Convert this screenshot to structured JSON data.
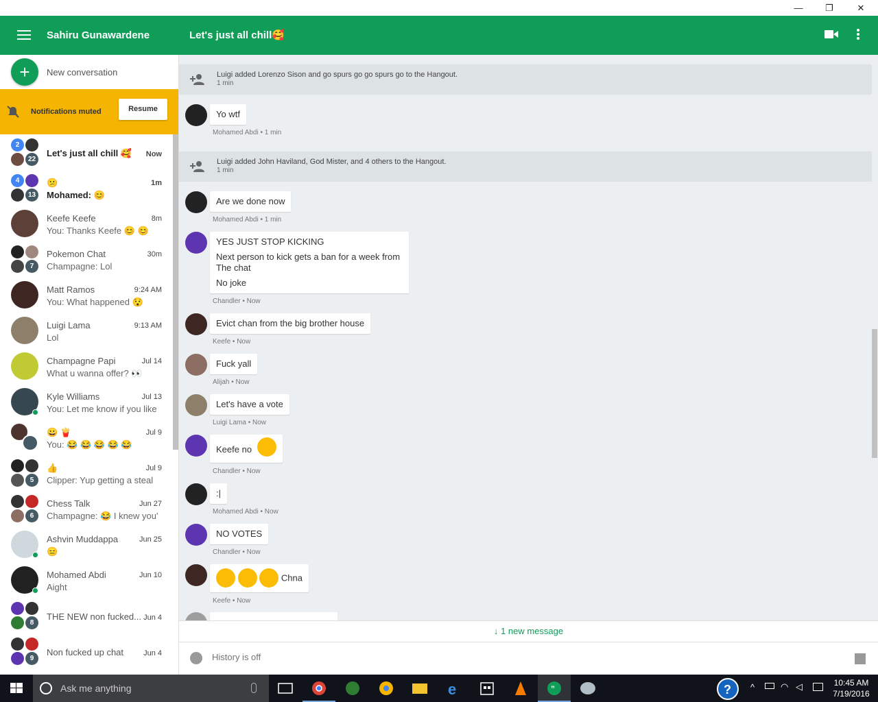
{
  "window": {
    "minimize": "—",
    "restore": "❐",
    "close": "✕"
  },
  "header": {
    "user_name": "Sahiru Gunawardene",
    "conversation_title": "Let's just all chill🥰"
  },
  "sidebar": {
    "new_conversation": "New conversation",
    "notifications_muted": "Notifications muted",
    "resume": "Resume",
    "conversations": [
      {
        "name": "Let's just all chill 🥰",
        "sub": "",
        "time": "Now",
        "badge_top": "2",
        "badge_bottom": "22",
        "bold": true
      },
      {
        "name": "😕",
        "sub": "Mohamed: 😊",
        "time": "1m",
        "badge_top": "4",
        "badge_bottom": "13",
        "bold": true
      },
      {
        "name": "Keefe Keefe",
        "sub": "You: Thanks Keefe 😊 😊",
        "time": "8m"
      },
      {
        "name": "Pokemon Chat",
        "sub": "Champagne: Lol",
        "time": "30m",
        "badge_bottom": "7"
      },
      {
        "name": "Matt Ramos",
        "sub": "You: What happened 😯",
        "time": "9:24 AM"
      },
      {
        "name": "Luigi Lama",
        "sub": "Lol",
        "time": "9:13 AM"
      },
      {
        "name": "Champagne Papi",
        "sub": "What u wanna offer? 👀",
        "time": "Jul 14"
      },
      {
        "name": "Kyle Williams",
        "sub": "You: Let me know if you like",
        "time": "Jul 13"
      },
      {
        "name": "😀 🍟",
        "sub": "You: 😂 😂 😂 😂 😂",
        "time": "Jul 9"
      },
      {
        "name": "👍",
        "sub": "Clipper: Yup getting a steal",
        "time": "Jul 9",
        "badge_bottom": "5"
      },
      {
        "name": "Chess Talk",
        "sub": "Champagne: 😂 I knew you'",
        "time": "Jun 27",
        "badge_bottom": "6"
      },
      {
        "name": "Ashvin Muddappa",
        "sub": "😑",
        "time": "Jun 25"
      },
      {
        "name": "Mohamed Abdi",
        "sub": "Aight",
        "time": "Jun 10"
      },
      {
        "name": "THE NEW non fucked...",
        "sub": "",
        "time": "Jun 4",
        "badge_bottom": "8"
      },
      {
        "name": "Non fucked up chat",
        "sub": "",
        "time": "Jun 4",
        "badge_bottom": "9"
      }
    ]
  },
  "chat": {
    "system_1": {
      "text": "Luigi added Lorenzo Sison and go spurs go go spurs go to the Hangout.",
      "time": "1 min"
    },
    "system_2": {
      "text": "Luigi added John Haviland, God Mister, and 4 others to the Hangout.",
      "time": "1 min"
    },
    "messages": [
      {
        "lines": [
          "Yo wtf"
        ],
        "meta": "Mohamed Abdi • 1 min"
      },
      {
        "lines": [
          "Are we done now"
        ],
        "meta": "Mohamed Abdi • 1 min"
      },
      {
        "lines": [
          "YES JUST STOP KICKING",
          "Next person to kick gets a ban for a week from The chat",
          "No joke"
        ],
        "meta": "Chandler • Now"
      },
      {
        "lines": [
          "Evict chan from the big brother house"
        ],
        "meta": "Keefe • Now"
      },
      {
        "lines": [
          "Fuck yall"
        ],
        "meta": "Alijah • Now"
      },
      {
        "lines": [
          "Let's have a vote"
        ],
        "meta": "Luigi Lama • Now"
      },
      {
        "lines": [
          "Keefe no"
        ],
        "meta": "Chandler • Now"
      },
      {
        "lines": [
          ":|"
        ],
        "meta": "Mohamed Abdi • Now"
      },
      {
        "lines": [
          "NO VOTES"
        ],
        "meta": "Chandler • Now"
      },
      {
        "lines": [
          "Chna"
        ],
        "meta": "Keefe • Now"
      }
    ],
    "new_message": "1 new message",
    "composer_placeholder": "History is off"
  },
  "taskbar": {
    "search_placeholder": "Ask me anything",
    "time": "10:45 AM",
    "date": "7/19/2016"
  },
  "colors": {
    "brand": "#0f9d58",
    "muted_bar": "#f4b400",
    "chat_bg": "#eceff1"
  }
}
